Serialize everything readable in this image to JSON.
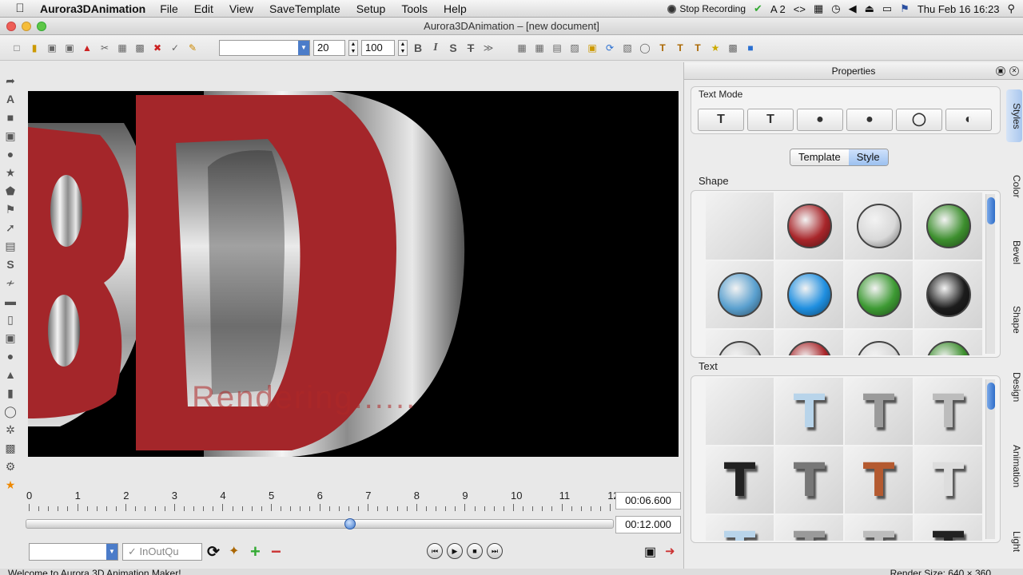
{
  "menubar": {
    "app_name": "Aurora3DAnimation",
    "items": [
      "File",
      "Edit",
      "View",
      "SaveTemplate",
      "Setup",
      "Tools",
      "Help"
    ],
    "stop_recording": "Stop Recording",
    "input_indicator": "2",
    "clock": "Thu Feb 16  16:23"
  },
  "window": {
    "title": "Aurora3DAnimation – [new document]"
  },
  "toolbar": {
    "font_size": "20",
    "scale": "100",
    "format_buttons": [
      "B",
      "I",
      "S",
      "T"
    ]
  },
  "canvas": {
    "overlay_text": "Rendering......"
  },
  "timeline": {
    "ticks": [
      "0",
      "1",
      "2",
      "3",
      "4",
      "5",
      "6",
      "7",
      "8",
      "9",
      "10",
      "11",
      "12"
    ],
    "current_time": "00:06.600",
    "total_time": "00:12.000",
    "position_fraction": 0.55
  },
  "bottom": {
    "easing": "InOutQu"
  },
  "status": {
    "left": "Welcome to Aurora 3D Animation Maker!",
    "right": "Render Size: 640 × 360"
  },
  "properties": {
    "title": "Properties",
    "text_mode_label": "Text Mode",
    "tabs": [
      "Template",
      "Style"
    ],
    "active_tab": "Style",
    "shape_label": "Shape",
    "text_label": "Text",
    "side_tabs": [
      "Styles",
      "Color",
      "Bevel",
      "Shape",
      "Design",
      "Animation",
      "Light"
    ],
    "shape_colors": [
      "#cfcfcf",
      "#a8262a",
      "#d9d9d9",
      "#3d8f2e",
      "#5aa0cf",
      "#1f8fe0",
      "#3d9a33",
      "#1c1c1c"
    ],
    "text_styles": [
      "#b8d4ea",
      "#9a9a9a",
      "#bcbcbc",
      "#222222",
      "#777777",
      "#b45a30",
      "#dddddd"
    ]
  }
}
